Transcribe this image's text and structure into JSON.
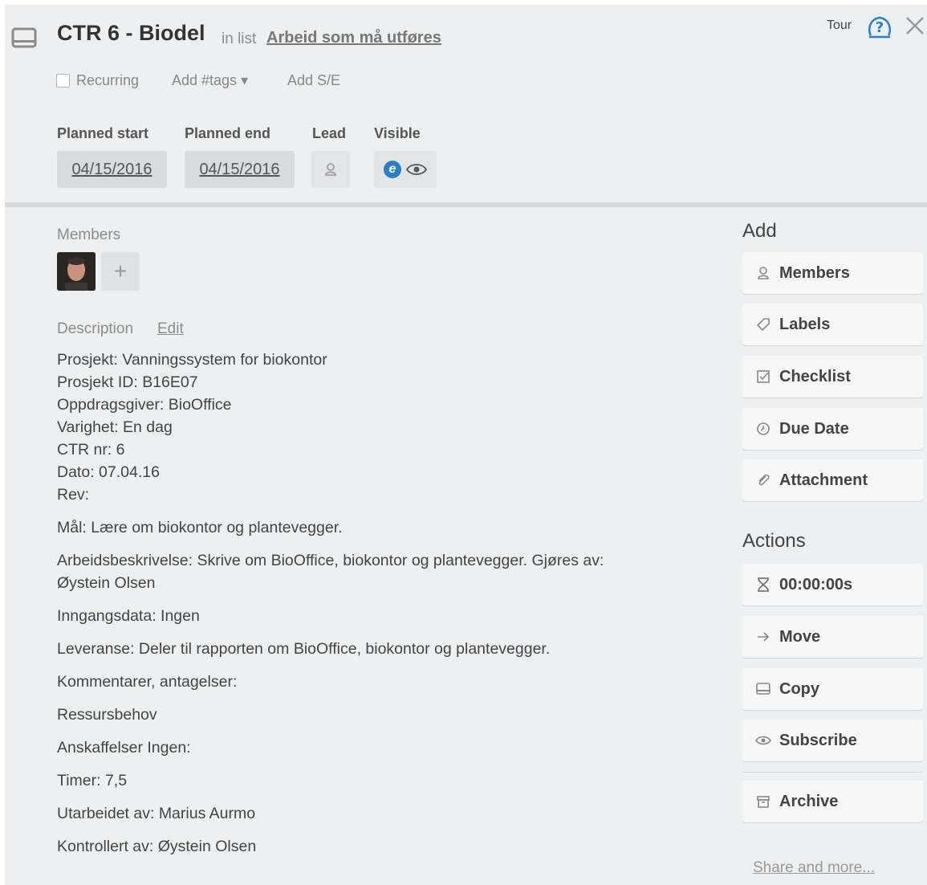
{
  "card": {
    "title": "CTR 6 - Biodel",
    "in_list_text": "in list",
    "list_name": "Arbeid som må utføres",
    "tour_label": "Tour",
    "recurring_label": "Recurring",
    "add_tags_label": "Add #tags ▾",
    "add_se_label": "Add S/E"
  },
  "fields": {
    "planned_start_label": "Planned start",
    "planned_start_value": "04/15/2016",
    "planned_end_label": "Planned end",
    "planned_end_value": "04/15/2016",
    "lead_label": "Lead",
    "visible_label": "Visible",
    "visible_badge": "e"
  },
  "members": {
    "label": "Members",
    "add_symbol": "+"
  },
  "description": {
    "label": "Description",
    "edit_label": "Edit",
    "block_lines": [
      "Prosjekt: Vanningssystem for biokontor",
      "Prosjekt ID: B16E07",
      "Oppdragsgiver: BioOffice",
      "Varighet: En dag",
      "CTR nr: 6",
      "Dato: 07.04.16",
      "Rev:"
    ],
    "paragraphs": [
      "Mål: Lære om biokontor og plantevegger.",
      "Arbeidsbeskrivelse: Skrive om BioOffice, biokontor og plantevegger. Gjøres av:",
      "Inngangsdata: Ingen",
      "Leveranse: Deler til rapporten om BioOffice, biokontor og plantevegger.",
      "Kommentarer, antagelser:",
      "Ressursbehov",
      "Anskaffelser Ingen:",
      "Timer: 7,5",
      "Utarbeidet av: Marius Aurmo",
      "Kontrollert av: Øystein Olsen"
    ],
    "paragraph_continuation": "Øystein Olsen"
  },
  "sidebar": {
    "add_heading": "Add",
    "add_buttons": [
      {
        "label": "Members",
        "icon": "person-icon"
      },
      {
        "label": "Labels",
        "icon": "tag-icon"
      },
      {
        "label": "Checklist",
        "icon": "checkbox-icon"
      },
      {
        "label": "Due Date",
        "icon": "clock-icon"
      },
      {
        "label": "Attachment",
        "icon": "paperclip-icon"
      }
    ],
    "actions_heading": "Actions",
    "action_buttons": [
      {
        "label": "00:00:00s",
        "icon": "hourglass-icon"
      },
      {
        "label": "Move",
        "icon": "arrow-right-icon"
      },
      {
        "label": "Copy",
        "icon": "card-icon"
      },
      {
        "label": "Subscribe",
        "icon": "eye-icon"
      },
      {
        "label": "Archive",
        "icon": "archive-icon"
      }
    ],
    "share_label": "Share and more..."
  },
  "colors": {
    "background": "#edeff0",
    "button_bg": "#f7f7f7",
    "date_bg": "#d9dcde",
    "badge_blue": "#2a7fc5",
    "tour_icon_blue": "#2a7fc5"
  }
}
